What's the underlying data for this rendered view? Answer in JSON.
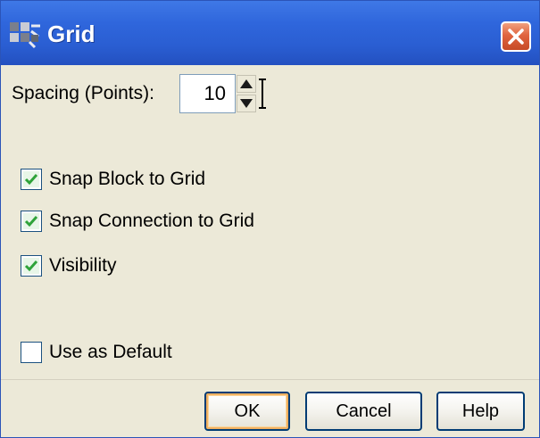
{
  "window": {
    "title": "Grid",
    "icons": {
      "app": "grid-app-icon",
      "close": "close-icon"
    },
    "colors": {
      "titlebar": "#2f66dc",
      "close": "#e0643f",
      "check": "#2fa33a"
    }
  },
  "spacing": {
    "label": "Spacing (Points):",
    "value": "10"
  },
  "options": [
    {
      "label": "Snap Block to Grid",
      "checked": true
    },
    {
      "label": "Snap Connection to Grid",
      "checked": true
    },
    {
      "label": "Visibility",
      "checked": true
    }
  ],
  "default_option": {
    "label": "Use as Default",
    "checked": false
  },
  "buttons": {
    "ok": "OK",
    "cancel": "Cancel",
    "help": "Help"
  }
}
